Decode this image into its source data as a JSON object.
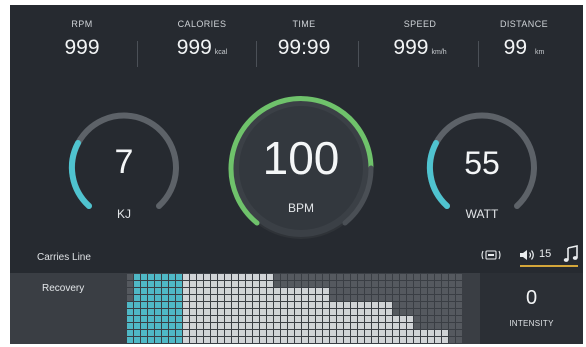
{
  "stats": [
    {
      "label": "RPM",
      "value": "999",
      "unit": ""
    },
    {
      "label": "CALORIES",
      "value": "999",
      "unit": "kcal"
    },
    {
      "label": "TIME",
      "value": "99:99",
      "unit": ""
    },
    {
      "label": "SPEED",
      "value": "999",
      "unit": "km/h"
    },
    {
      "label": "DISTANCE",
      "value": "99",
      "unit": "km"
    }
  ],
  "gauges": {
    "left": {
      "value": "7",
      "label": "KJ",
      "accent": "#4fc3cf"
    },
    "center": {
      "value": "100",
      "label": "BPM",
      "accent": "#6fc26b"
    },
    "right": {
      "value": "55",
      "label": "WATT",
      "accent": "#4fc3cf"
    }
  },
  "status": {
    "profile_name": "Carries Line",
    "volume_icon": "speaker-icon",
    "volume_level": "15",
    "display_icon": "screen-mirror-icon",
    "music_icon": "music-note-icon"
  },
  "profile": {
    "label": "Recovery",
    "current_segment_color": "#4fb8c6",
    "bar_color": "#d0d3d6",
    "empty_color": "#55595f",
    "levels": [
      3,
      5,
      5,
      5,
      5,
      5,
      5,
      5,
      5,
      5,
      5,
      5,
      5,
      5,
      5,
      5,
      5,
      5,
      5,
      5,
      5,
      4,
      4,
      4,
      4,
      4,
      4,
      4,
      4,
      3,
      3,
      3,
      3,
      3,
      3,
      3,
      3,
      3,
      2,
      2,
      2,
      1,
      1,
      1,
      1,
      1,
      0,
      0
    ],
    "active_columns": [
      0,
      1,
      2,
      3,
      4,
      5,
      6,
      7
    ]
  },
  "intensity": {
    "value": "0",
    "label": "INTENSITY"
  }
}
